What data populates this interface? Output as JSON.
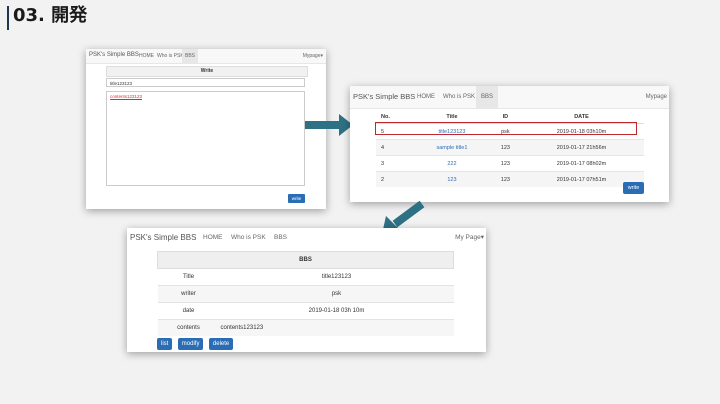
{
  "slide": {
    "title": "03. 開発"
  },
  "write_page": {
    "brand": "PSK's Simple BBS",
    "nav": [
      "HOME",
      "Who is PSK",
      "BBS"
    ],
    "right": "Mypage▾",
    "panel_title": "Write",
    "title_value": "title123123",
    "contents_value": "contents123123",
    "write_button": "write"
  },
  "list_page": {
    "brand": "PSK's Simple BBS",
    "nav": [
      "HOME",
      "Who is PSK",
      "BBS"
    ],
    "right": "Mypage",
    "columns": [
      "No.",
      "Title",
      "ID",
      "DATE"
    ],
    "rows": [
      [
        "5",
        "title123123",
        "psk",
        "2019-01-18 03h10m"
      ],
      [
        "4",
        "sample title1",
        "123",
        "2019-01-17 21h56m"
      ],
      [
        "3",
        "222",
        "123",
        "2019-01-17 08h02m"
      ],
      [
        "2",
        "123",
        "123",
        "2019-01-17 07h51m"
      ]
    ],
    "write_button": "write"
  },
  "view_page": {
    "brand": "PSK's Simple BBS",
    "nav": [
      "HOME",
      "Who is PSK",
      "BBS"
    ],
    "right": "My Page▾",
    "table_title": "BBS",
    "fields": [
      {
        "key": "Title",
        "value": "title123123"
      },
      {
        "key": "writer",
        "value": "psk"
      },
      {
        "key": "date",
        "value": "2019-01-18 03h 10m"
      },
      {
        "key": "contents",
        "value": "contents123123"
      }
    ],
    "buttons": [
      "list",
      "modify",
      "delete"
    ]
  },
  "colors": {
    "accent": "#2a6db4",
    "arrow": "#2e7185",
    "highlight": "#c0272d"
  }
}
